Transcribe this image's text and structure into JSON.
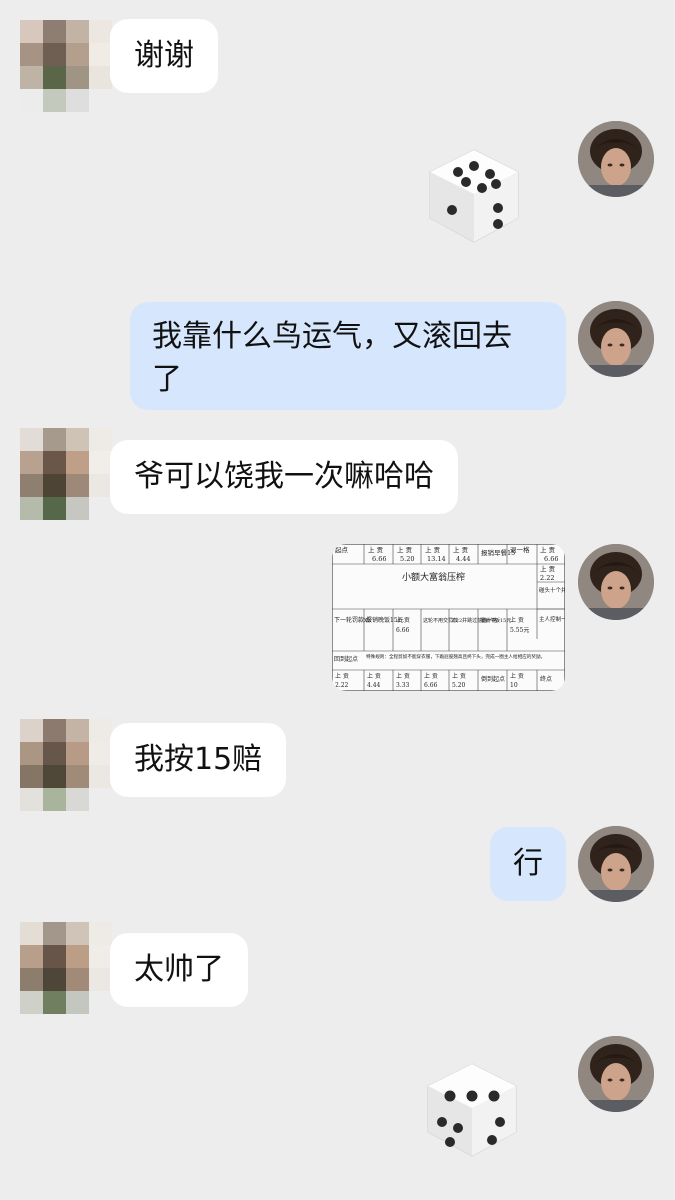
{
  "messages": [
    {
      "sender": "other",
      "type": "text",
      "text": "谢谢"
    },
    {
      "sender": "self",
      "type": "dice",
      "face": 6
    },
    {
      "sender": "self",
      "type": "text",
      "text": "我靠什么鸟运气，又滚回去了"
    },
    {
      "sender": "other",
      "type": "text",
      "text": "爷可以饶我一次嘛哈哈"
    },
    {
      "sender": "self",
      "type": "image",
      "image": {
        "title": "小额大富翁压榨",
        "cells_row1": [
          "起点",
          "上 贡 6.66",
          "上 贡 5.20",
          "上 贡 13.14",
          "上 贡 4.44",
          "报销早餐15",
          "退一格",
          "上 6.66"
        ],
        "cells_right": [
          "上 贡 2.22",
          "碰头十个并回到起点",
          "主人控制一次点数"
        ],
        "cells_row3": [
          "下一轮罚款x2",
          "报销晚饭15元",
          "上 贡 6.66",
          "这轮不用交罚款",
          "2.22 并跳过前面一格",
          "报销午饭15元",
          "上 贡 5.55元"
        ],
        "rule": "特殊规则：全程剪奴不能穿衣服，下跪屁股翘高且终下头，完成一圈主人给相应的奖励。",
        "cells_bottom": [
          "回到起点",
          "上 贡 2.22",
          "上 贡 4.44",
          "上 贡 3.33",
          "上 贡 6.66",
          "上 贡 5.20",
          "倒到起点",
          "上 贡 10",
          "终点"
        ]
      }
    },
    {
      "sender": "other",
      "type": "text",
      "text": "我按15赔"
    },
    {
      "sender": "self",
      "type": "text",
      "text": "行"
    },
    {
      "sender": "other",
      "type": "text",
      "text": "太帅了"
    },
    {
      "sender": "self",
      "type": "dice",
      "face": 5
    }
  ],
  "bubble_text": {
    "m1": "谢谢",
    "m3_line1": "我靠什么鸟运气，又滚回去",
    "m3_line2": "了",
    "m4": "爷可以饶我一次嘛哈哈",
    "m6": "我按15赔",
    "m7": "行",
    "m8": "太帅了"
  },
  "screenshot_text": {
    "title": "小额大富翁压榨",
    "c_start": "起点",
    "c_gong": "上 贡",
    "v1": "6.66",
    "v2": "5.20",
    "v3": "13.14",
    "v4": "4.44",
    "breakfast": "报销早餐15",
    "back1": "退一格",
    "r_a": "2.22",
    "r_b": "碰头十个并回到起点",
    "r_c": "主人控制一次点数",
    "d1": "下一轮罚款x2",
    "d2": "报销晚饭15元",
    "d3": "6.66",
    "d4": "这轮不用交罚款",
    "d5": "2.22并跳过前面一格",
    "d6": "报销午饭15元",
    "d7": "5.55元",
    "back_start": "回到起点",
    "rule": "特殊规则：全程剪奴不能穿衣服，下跪屁股翘高且终下头，完成一圈主人给相应的奖励。",
    "b1": "2.22",
    "b2": "4.44",
    "b3": "3.33",
    "b4": "6.66",
    "b5": "5.20",
    "b6": "倒到起点",
    "b7": "10",
    "b8": "终点"
  },
  "colors": {
    "background": "#ededed",
    "incoming_bubble": "#ffffff",
    "outgoing_bubble": "#d5e6fd"
  }
}
